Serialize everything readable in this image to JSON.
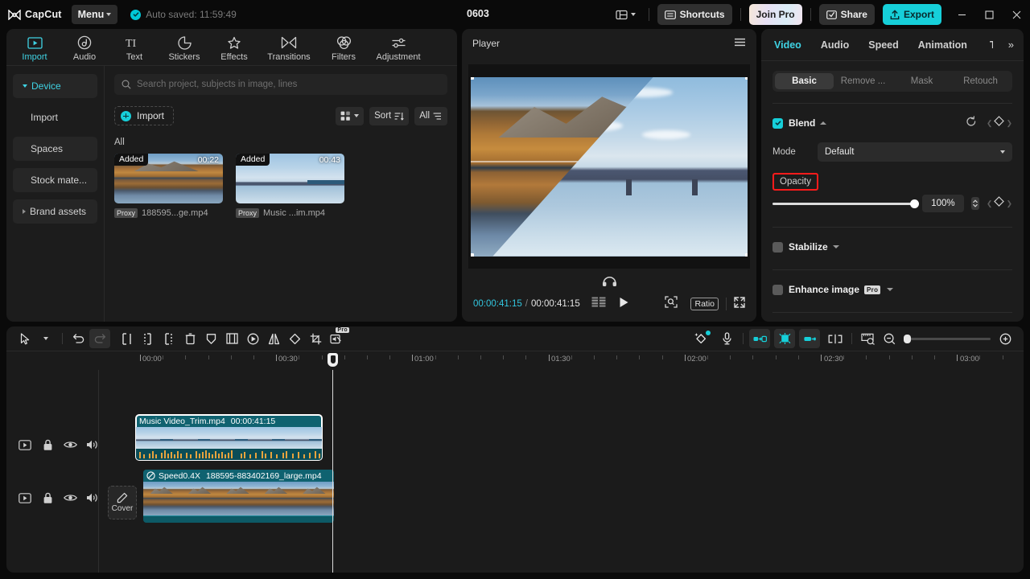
{
  "app": {
    "brand": "CapCut",
    "menu_label": "Menu",
    "autosave_text": "Auto saved: 11:59:49",
    "project_name": "0603"
  },
  "titlebar": {
    "shortcuts_label": "Shortcuts",
    "join_pro_label": "Join Pro",
    "share_label": "Share",
    "export_label": "Export",
    "minimize_icon": "minimize-icon",
    "maximize_icon": "maximize-icon",
    "close_icon": "close-icon",
    "layout_icon": "layout-icon"
  },
  "tools": [
    {
      "label": "Import",
      "icon": "import-icon",
      "active": true
    },
    {
      "label": "Audio",
      "icon": "audio-icon",
      "active": false
    },
    {
      "label": "Text",
      "icon": "text-icon",
      "active": false
    },
    {
      "label": "Stickers",
      "icon": "stickers-icon",
      "active": false
    },
    {
      "label": "Effects",
      "icon": "effects-icon",
      "active": false
    },
    {
      "label": "Transitions",
      "icon": "transitions-icon",
      "active": false
    },
    {
      "label": "Filters",
      "icon": "filters-icon",
      "active": false
    },
    {
      "label": "Adjustment",
      "icon": "adjustment-icon",
      "active": false
    }
  ],
  "sidenav": [
    {
      "label": "Device",
      "active": true,
      "expandable": true
    },
    {
      "label": "Import",
      "active": false,
      "expandable": false
    },
    {
      "label": "Spaces",
      "active": false,
      "expandable": false
    },
    {
      "label": "Stock mate...",
      "active": false,
      "expandable": false
    },
    {
      "label": "Brand assets",
      "active": false,
      "expandable": true
    }
  ],
  "media": {
    "search_placeholder": "Search project, subjects in image, lines",
    "import_label": "Import",
    "sort_label": "Sort",
    "filter_label": "All",
    "group_label": "All",
    "items": [
      {
        "badge": "Added",
        "duration": "00:22",
        "proxy": "Proxy",
        "name": "188595...ge.mp4",
        "art": "art-lake"
      },
      {
        "badge": "Added",
        "duration": "00:43",
        "proxy": "Proxy",
        "name": "Music ...im.mp4",
        "art": "art-bridge"
      }
    ]
  },
  "player": {
    "title": "Player",
    "menu_icon": "hamburger-icon",
    "current_time": "00:00:41:15",
    "total_time": "00:00:41:15",
    "time_separator": "/",
    "ratio_label": "Ratio",
    "play_icon": "play-icon",
    "frames_icon": "frames-icon",
    "fit_icon": "fit-screen-icon",
    "fullscreen_icon": "fullscreen-icon",
    "audio_icon": "headphone-icon"
  },
  "inspector": {
    "tabs": [
      {
        "label": "Video",
        "active": true
      },
      {
        "label": "Audio",
        "active": false
      },
      {
        "label": "Speed",
        "active": false
      },
      {
        "label": "Animation",
        "active": false
      }
    ],
    "overflow_icon": "double-chevron-right-icon",
    "segments": [
      {
        "label": "Basic",
        "active": true
      },
      {
        "label": "Remove ...",
        "active": false
      },
      {
        "label": "Mask",
        "active": false
      },
      {
        "label": "Retouch",
        "active": false
      }
    ],
    "blend": {
      "title": "Blend",
      "checked": true,
      "reset_icon": "reset-icon",
      "keyframe_icon": "keyframe-icon",
      "mode_label": "Mode",
      "mode_value": "Default",
      "opacity_label": "Opacity",
      "opacity_value": "100%",
      "opacity_percent": 100,
      "highlight_color": "#ff1b1b"
    },
    "stabilize": {
      "title": "Stabilize",
      "checked": false
    },
    "enhance": {
      "title": "Enhance image",
      "checked": false,
      "pro_tag": "Pro"
    }
  },
  "timeline": {
    "toolbar_left": [
      {
        "icon": "select-arrow-icon",
        "name": "select-tool"
      },
      {
        "icon": "chevron-down-icon",
        "name": "select-tool-dropdown"
      },
      {
        "icon": "undo-icon",
        "name": "undo-button"
      },
      {
        "icon": "redo-icon",
        "name": "redo-button"
      },
      {
        "icon": "split-left-icon",
        "name": "split-button"
      },
      {
        "icon": "trim-start-icon",
        "name": "trim-start-button"
      },
      {
        "icon": "trim-end-icon",
        "name": "trim-end-button"
      },
      {
        "icon": "delete-icon",
        "name": "delete-button"
      },
      {
        "icon": "marker-icon",
        "name": "marker-button"
      },
      {
        "icon": "freeze-icon",
        "name": "freeze-frame-button"
      },
      {
        "icon": "reverse-icon",
        "name": "reverse-button"
      },
      {
        "icon": "mirror-icon",
        "name": "mirror-button"
      },
      {
        "icon": "rotate-icon",
        "name": "rotate-button"
      },
      {
        "icon": "crop-icon",
        "name": "crop-button"
      },
      {
        "icon": "mute-pro-icon",
        "name": "mute-pro-button"
      }
    ],
    "toolbar_right": [
      {
        "icon": "auto-cut-icon",
        "name": "auto-cut-button"
      },
      {
        "icon": "microphone-icon",
        "name": "record-voiceover-button"
      },
      {
        "icon": "link-left-icon",
        "name": "link-left-button"
      },
      {
        "icon": "auto-snap-icon",
        "name": "auto-snap-button"
      },
      {
        "icon": "link-icon",
        "name": "link-button"
      },
      {
        "icon": "split-track-icon",
        "name": "split-track-button"
      },
      {
        "icon": "zoom-fit-icon",
        "name": "zoom-to-fit-button"
      },
      {
        "icon": "zoom-out-icon",
        "name": "zoom-out-button"
      },
      {
        "icon": "zoom-in-icon",
        "name": "zoom-in-button"
      }
    ],
    "ruler_labels": [
      "00:00",
      "00:30",
      "01:00",
      "01:30",
      "02:00",
      "02:30",
      "03:00"
    ],
    "playhead_time": "00:00:41:15",
    "cover_label": "Cover",
    "track_header_icons": [
      "track-preview-icon",
      "lock-icon",
      "eye-icon",
      "volume-icon"
    ],
    "clips": [
      {
        "name": "Music Video_Trim.mp4",
        "duration": "00:00:41:15",
        "selected": true,
        "art": "art-bridge",
        "has_waveform": true
      },
      {
        "speed_label": "Speed0.4X",
        "name": "188595-883402169_large.mp4",
        "selected": false,
        "art": "art-lake",
        "has_waveform": false
      }
    ]
  },
  "colors": {
    "accent": "#16cfd9",
    "accent_text": "#3fd3e4",
    "panel": "#1c1c1c",
    "clip_teal": "#0f6270",
    "highlight_red": "#ff1b1b"
  }
}
